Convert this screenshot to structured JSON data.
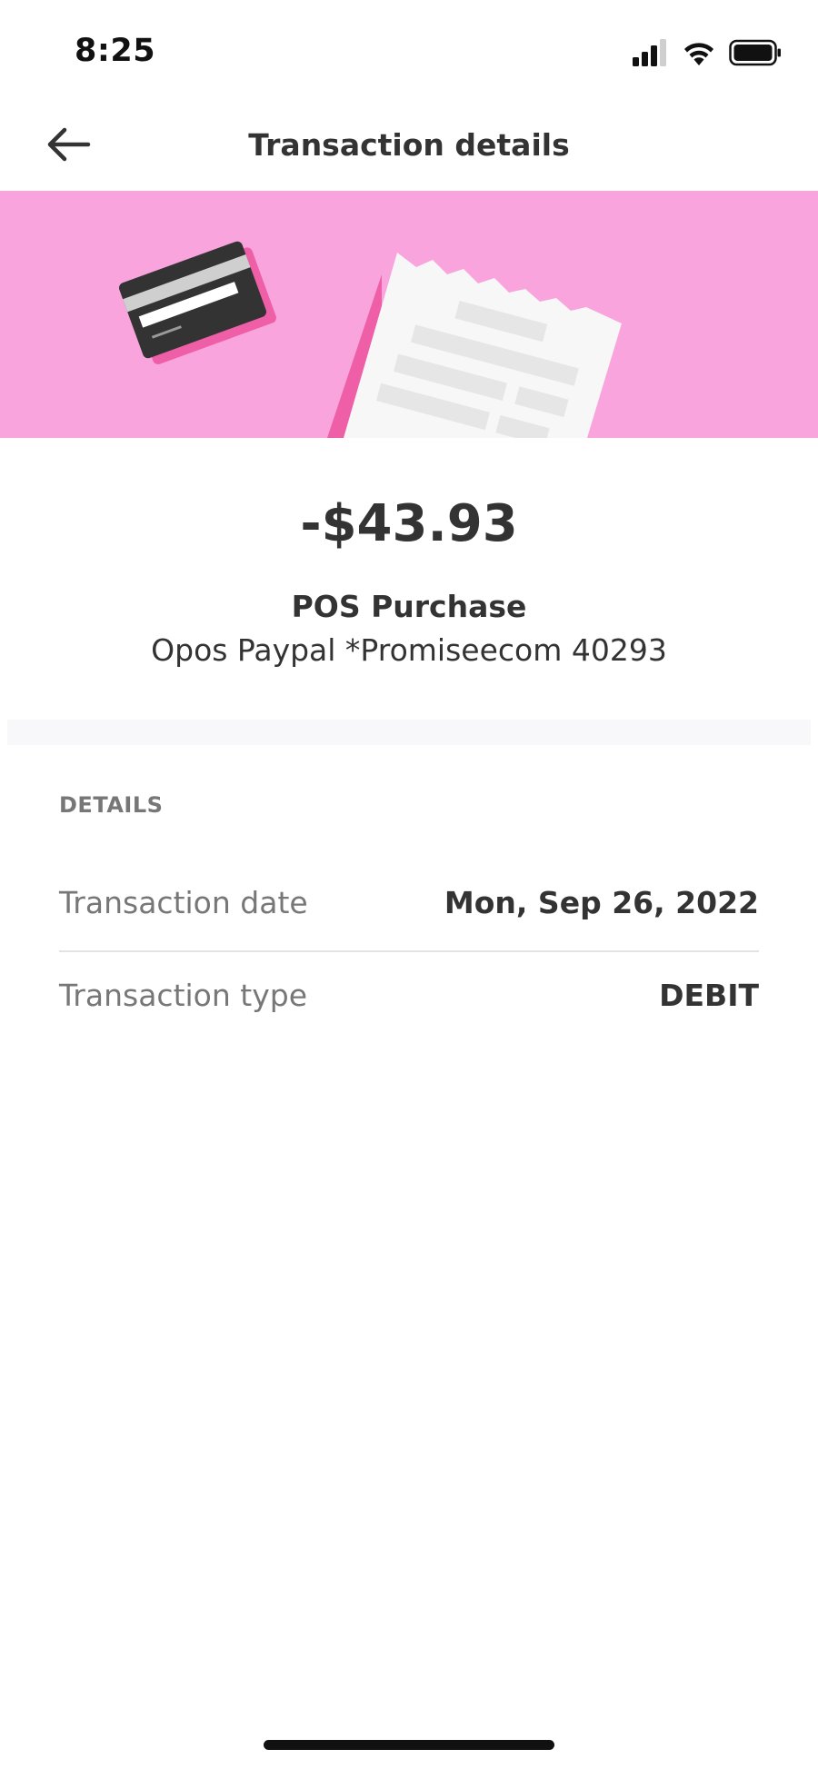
{
  "status_bar": {
    "time": "8:25",
    "icons": [
      "cellular-signal-icon",
      "wifi-icon",
      "battery-icon"
    ]
  },
  "header": {
    "title": "Transaction details",
    "back_icon": "arrow-left-icon"
  },
  "banner": {
    "illustration": [
      "credit-card-icon",
      "receipt-icon"
    ],
    "background_color": "#f9a4dc"
  },
  "transaction": {
    "amount": "-$43.93",
    "title": "POS Purchase",
    "merchant": "Opos Paypal *Promiseecom 40293"
  },
  "details": {
    "heading": "DETAILS",
    "rows": [
      {
        "label": "Transaction date",
        "value": "Mon, Sep 26, 2022"
      },
      {
        "label": "Transaction type",
        "value": "DEBIT"
      }
    ]
  }
}
